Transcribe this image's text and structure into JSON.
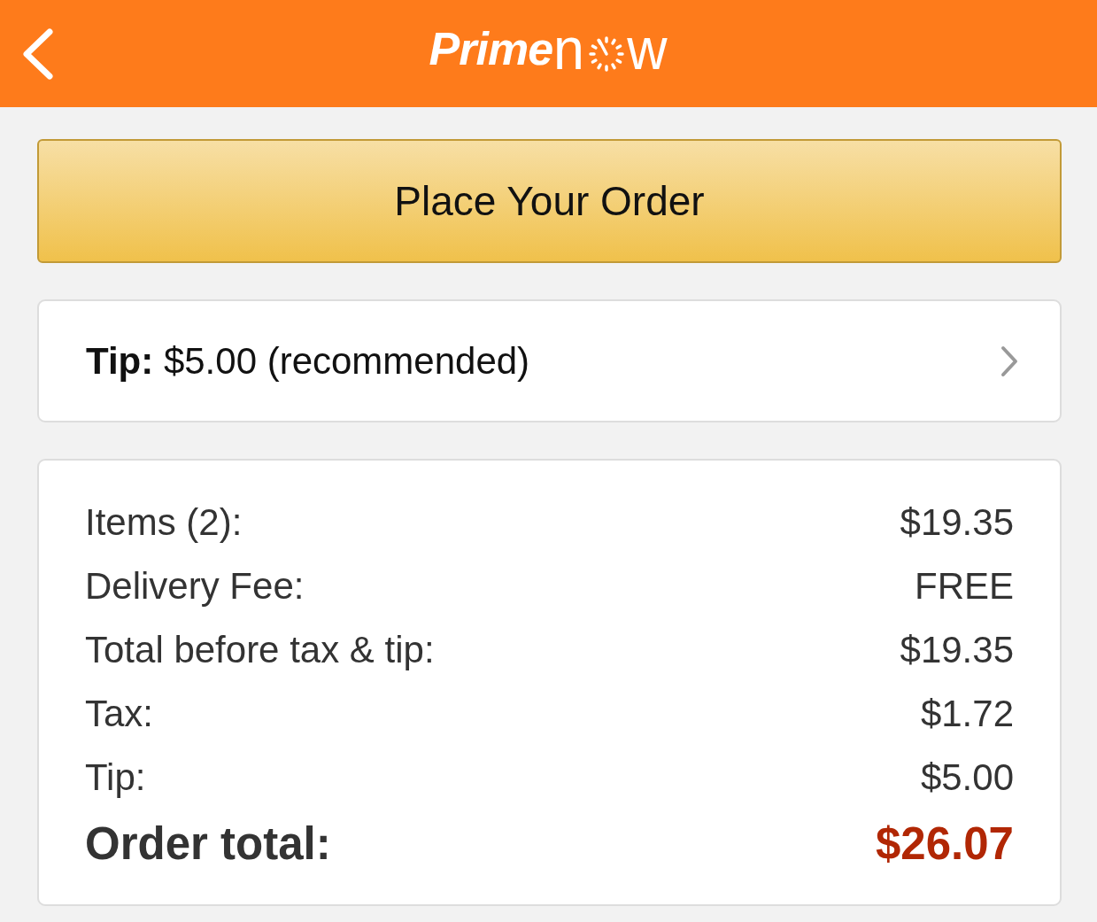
{
  "header": {
    "logo": {
      "prime": "Prime",
      "now_start": "n",
      "now_end": "w"
    }
  },
  "place_order_button": {
    "label": "Place Your Order"
  },
  "tip_selector": {
    "text": "**Tip:** $5.00 (recommended)"
  },
  "summary": {
    "lines": [
      {
        "kind": "line",
        "label": "Items (2):",
        "value": "$19.35"
      },
      {
        "kind": "line",
        "label": "Delivery Fee:",
        "value": "FREE"
      },
      {
        "kind": "line",
        "label": "Total before tax & tip:",
        "value": "$19.35"
      },
      {
        "kind": "line",
        "label": "Tax:",
        "value": "$1.72"
      },
      {
        "kind": "line",
        "label": "Tip:",
        "value": "$5.00"
      },
      {
        "kind": "total",
        "label": "Order total:",
        "value": "$26.07"
      }
    ]
  }
}
